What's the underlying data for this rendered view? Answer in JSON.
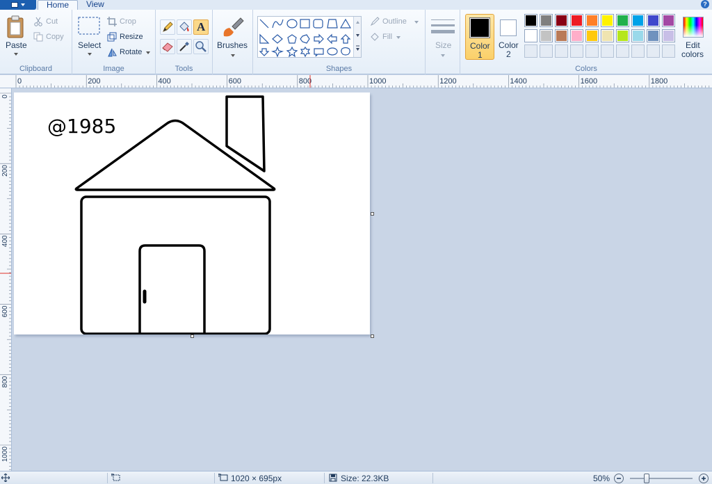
{
  "tabs": {
    "home": "Home",
    "view": "View"
  },
  "help_glyph": "?",
  "clipboard": {
    "paste": "Paste",
    "cut": "Cut",
    "copy": "Copy",
    "group": "Clipboard"
  },
  "image": {
    "select": "Select",
    "crop": "Crop",
    "resize": "Resize",
    "rotate": "Rotate",
    "group": "Image"
  },
  "tools": {
    "group": "Tools",
    "text_glyph": "A"
  },
  "brushes": {
    "label": "Brushes"
  },
  "shapes": {
    "outline": "Outline",
    "fill": "Fill",
    "group": "Shapes"
  },
  "size": {
    "label": "Size"
  },
  "colors": {
    "color1_line1": "Color",
    "color1_line2": "1",
    "color2_line1": "Color",
    "color2_line2": "2",
    "edit_line1": "Edit",
    "edit_line2": "colors",
    "group": "Colors",
    "color1_value": "#000000",
    "color2_value": "#ffffff",
    "row1": [
      "#000000",
      "#7f7f7f",
      "#880015",
      "#ed1c24",
      "#ff7f27",
      "#fff200",
      "#22b14c",
      "#00a2e8",
      "#3f48cc",
      "#a349a4"
    ],
    "row2": [
      "#ffffff",
      "#c3c3c3",
      "#b97a57",
      "#ffaec9",
      "#ffc90e",
      "#efe4b0",
      "#b5e61d",
      "#99d9ea",
      "#7092be",
      "#c8bfe7"
    ]
  },
  "ruler": {
    "h_labels": [
      "0",
      "200",
      "400",
      "600",
      "800",
      "1000",
      "1200",
      "1400",
      "1600",
      "1800"
    ],
    "v_labels": [
      "0",
      "200",
      "400",
      "600",
      "800",
      "1000"
    ]
  },
  "canvas": {
    "text": "@1985"
  },
  "status": {
    "dimensions": "1020 × 695px",
    "size": "Size: 22.3KB",
    "zoom": "50%"
  }
}
